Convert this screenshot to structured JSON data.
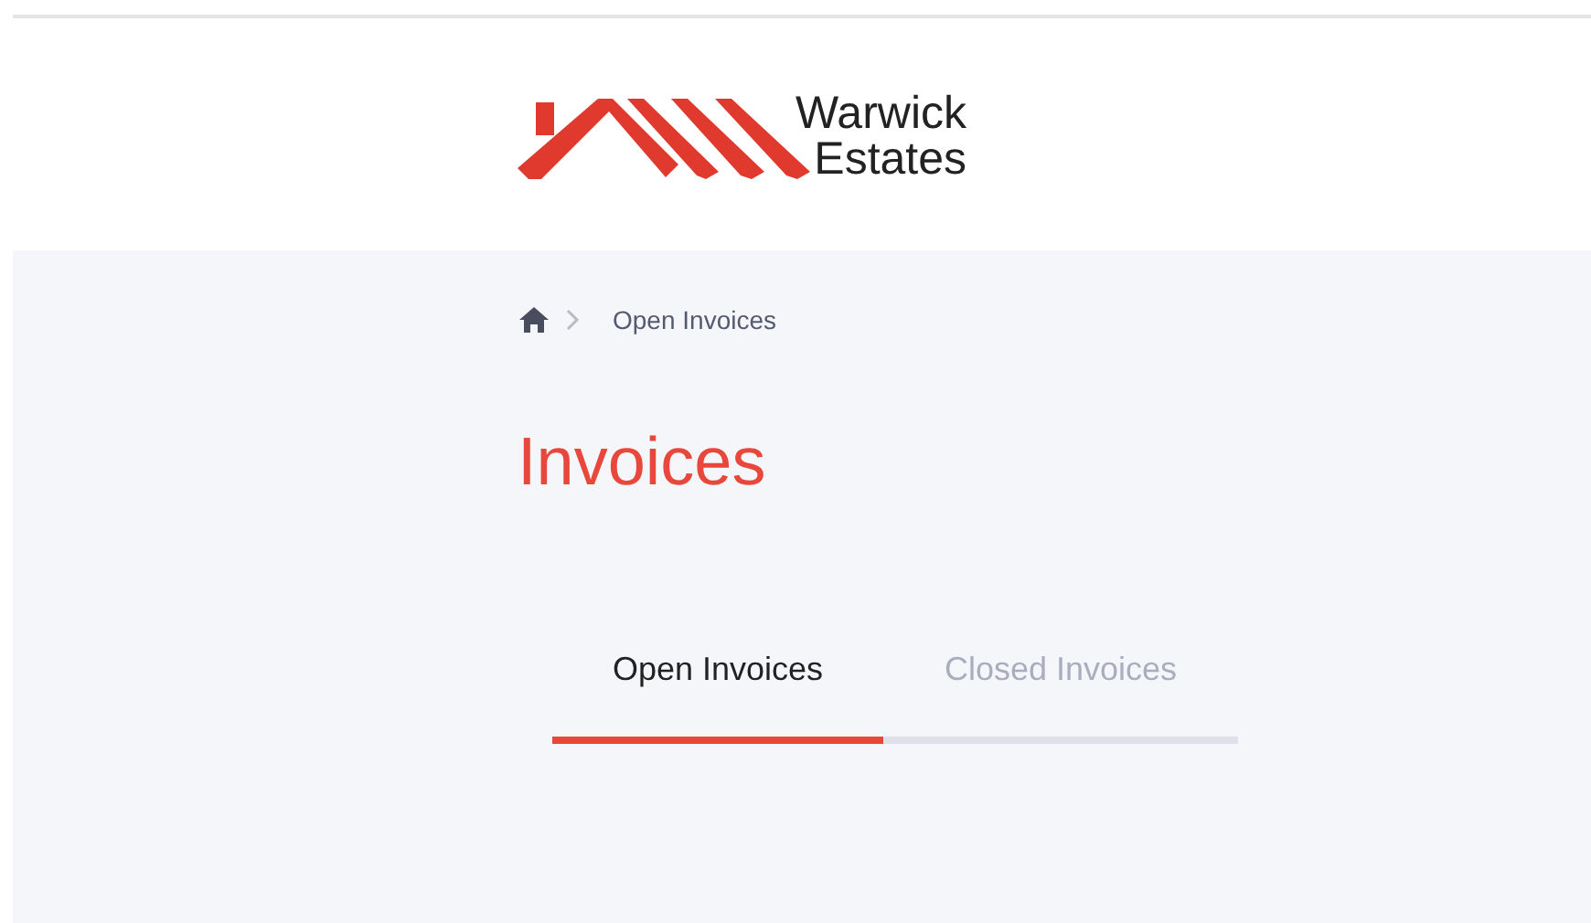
{
  "header": {
    "logo": {
      "line_1": "Warwick",
      "line_2": "Estates"
    }
  },
  "breadcrumb": {
    "items": [
      "Open Invoices"
    ]
  },
  "page_title": "Invoices",
  "tabs": [
    {
      "label": "Open Invoices",
      "selected": true
    },
    {
      "label": "Closed Invoices",
      "selected": false
    }
  ]
}
